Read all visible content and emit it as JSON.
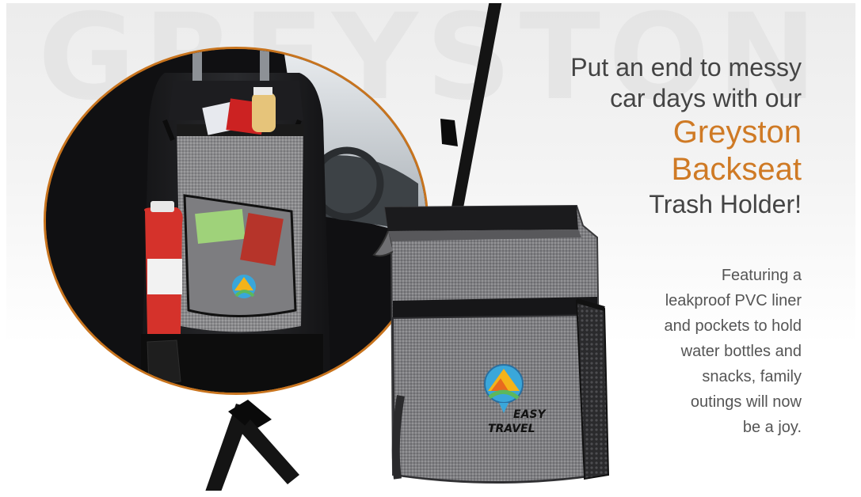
{
  "brand": {
    "watermark": "GREYSTON",
    "accent_color": "#cf7a25",
    "logo_text_line1": "EASY",
    "logo_text_line2": "TRAVEL"
  },
  "headline": {
    "line1": "Put an end to messy",
    "line2": "car days with our",
    "product_line1": "Greyston",
    "product_line2": "Backseat",
    "line3": "Trash Holder!"
  },
  "description": {
    "lines": [
      "Featuring a",
      "leakproof PVC liner",
      "and pockets to hold",
      "water bottles and",
      "snacks, family",
      "outings will now",
      "be a joy."
    ]
  }
}
